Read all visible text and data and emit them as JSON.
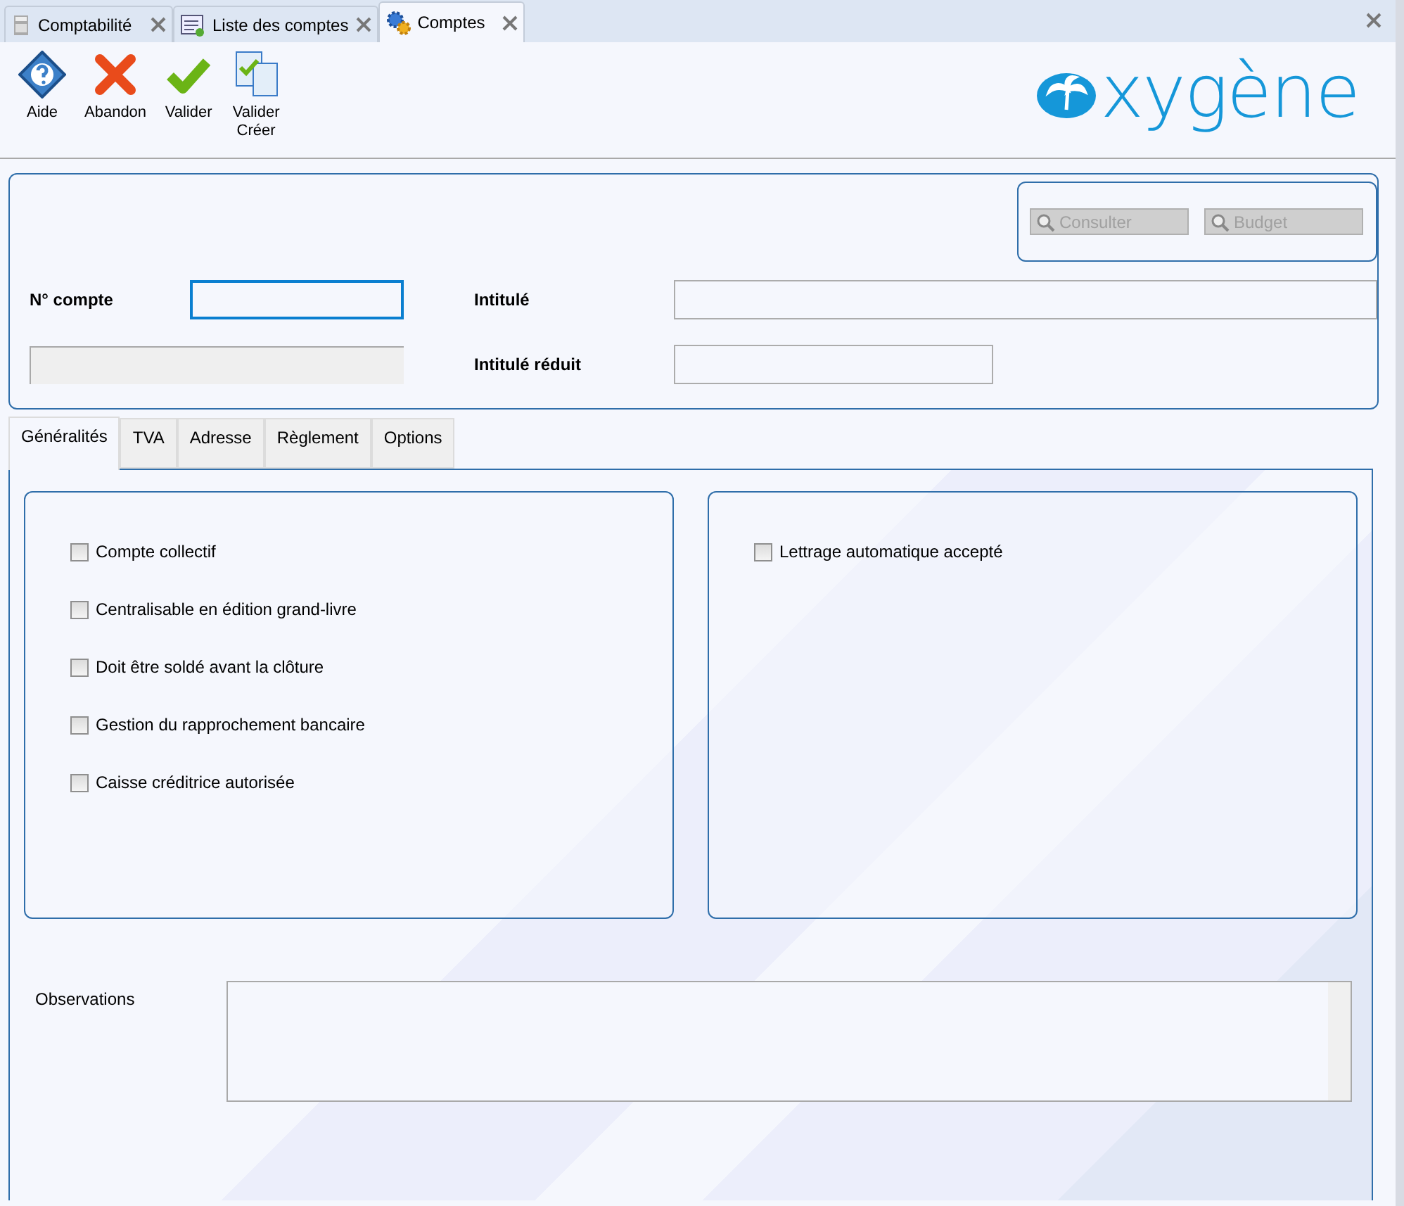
{
  "doc_tabs": [
    {
      "label": "Comptabilité",
      "kind": "calculator",
      "selected": false
    },
    {
      "label": "Liste des comptes",
      "kind": "list",
      "selected": false
    },
    {
      "label": "Comptes",
      "kind": "gears",
      "selected": true
    }
  ],
  "toolbar": [
    {
      "label": "Aide",
      "kind": "help"
    },
    {
      "label": "Abandon",
      "kind": "cancel"
    },
    {
      "label": "Valider",
      "kind": "check"
    },
    {
      "label": "Valider\nCréer",
      "kind": "docs"
    }
  ],
  "logo": {
    "text": "xygène"
  },
  "header": {
    "buttons": [
      {
        "label": "Consulter",
        "disabled": true
      },
      {
        "label": "Budget",
        "disabled": true
      }
    ],
    "account_label": "N° compte",
    "title_label": "Intitulé",
    "short_title_label": "Intitulé réduit"
  },
  "tabs": [
    {
      "label": "Généralités",
      "selected": true
    },
    {
      "label": "TVA",
      "selected": false
    },
    {
      "label": "Adresse",
      "selected": false
    },
    {
      "label": "Règlement",
      "selected": false
    },
    {
      "label": "Options",
      "selected": false
    }
  ],
  "left_options": [
    {
      "label": "Compte collectif",
      "checked": false
    },
    {
      "label": "Centralisable en édition grand-livre",
      "checked": false
    },
    {
      "label": "Doit être soldé avant la clôture",
      "checked": false
    },
    {
      "label": "Gestion du rapprochement bancaire",
      "checked": false
    },
    {
      "label": "Caisse créditrice autorisée",
      "checked": false
    }
  ],
  "right_options": [
    {
      "label": "Lettrage automatique accepté",
      "checked": false
    }
  ],
  "observations_label": "Observations"
}
